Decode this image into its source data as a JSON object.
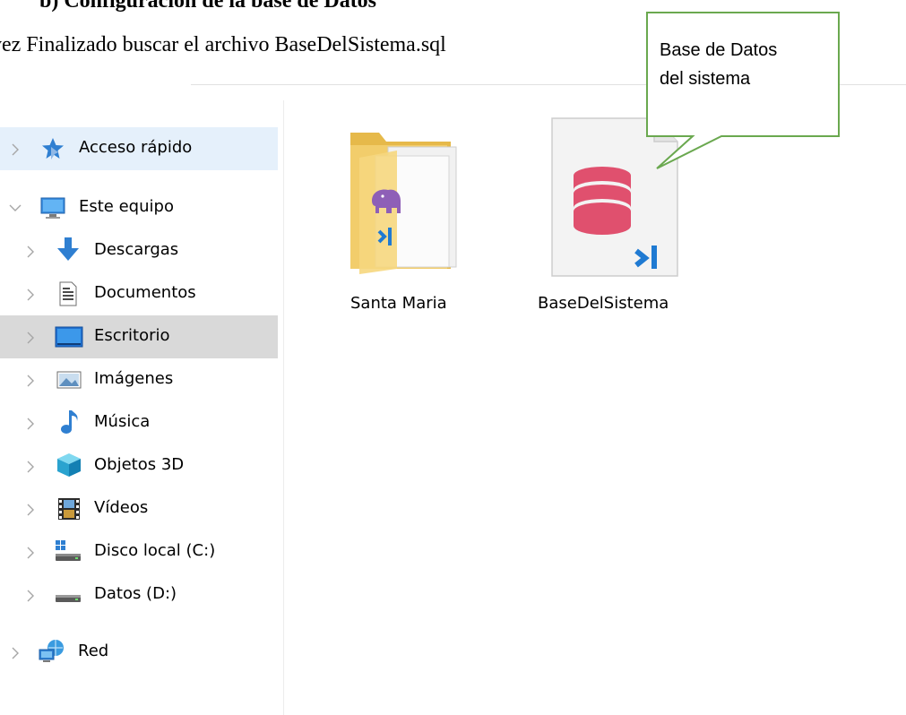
{
  "document": {
    "heading": "b)  Configuración de la base de Datos",
    "instruction": "vez Finalizado buscar el archivo BaseDelSistema.sql"
  },
  "callout": {
    "line1": "Base de Datos",
    "line2": "del sistema",
    "border_color": "#6aa84f"
  },
  "sidebar": {
    "items": [
      {
        "label": "Acceso rápido",
        "icon": "star-pin-icon"
      },
      {
        "label": "Este equipo",
        "icon": "computer-icon"
      },
      {
        "label": "Descargas",
        "icon": "download-arrow-icon"
      },
      {
        "label": "Documentos",
        "icon": "document-icon"
      },
      {
        "label": "Escritorio",
        "icon": "desktop-icon"
      },
      {
        "label": "Imágenes",
        "icon": "pictures-icon"
      },
      {
        "label": "Música",
        "icon": "music-note-icon"
      },
      {
        "label": "Objetos 3D",
        "icon": "cube-3d-icon"
      },
      {
        "label": "Vídeos",
        "icon": "film-icon"
      },
      {
        "label": "Disco local (C:)",
        "icon": "system-drive-icon"
      },
      {
        "label": "Datos (D:)",
        "icon": "drive-icon"
      },
      {
        "label": "Red",
        "icon": "network-icon"
      }
    ]
  },
  "files": [
    {
      "name": "Santa Maria",
      "type": "folder",
      "icon": "folder-icon"
    },
    {
      "name": "BaseDelSistema",
      "type": "sql-file",
      "icon": "database-file-icon"
    }
  ],
  "colors": {
    "quick_access_bg": "#e5f0fb",
    "selected_bg": "#d9d9d9",
    "database_red": "#e0506e",
    "vscode_blue": "#1f7ad2"
  }
}
